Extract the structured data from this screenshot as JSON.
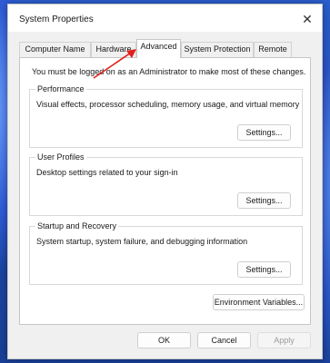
{
  "window": {
    "title": "System Properties",
    "close_glyph": "✕"
  },
  "tabs": [
    {
      "label": "Computer Name",
      "active": false
    },
    {
      "label": "Hardware",
      "active": false
    },
    {
      "label": "Advanced",
      "active": true
    },
    {
      "label": "System Protection",
      "active": false
    },
    {
      "label": "Remote",
      "active": false
    }
  ],
  "advanced": {
    "notice": "You must be logged on as an Administrator to make most of these changes.",
    "performance": {
      "label": "Performance",
      "description": "Visual effects, processor scheduling, memory usage, and virtual memory",
      "button": "Settings..."
    },
    "user_profiles": {
      "label": "User Profiles",
      "description": "Desktop settings related to your sign-in",
      "button": "Settings..."
    },
    "startup_recovery": {
      "label": "Startup and Recovery",
      "description": "System startup, system failure, and debugging information",
      "button": "Settings..."
    },
    "environment_button": "Environment Variables..."
  },
  "footer": {
    "ok": "OK",
    "cancel": "Cancel",
    "apply": "Apply",
    "apply_disabled": true
  },
  "annotation": {
    "arrow_color": "#e0201b"
  }
}
